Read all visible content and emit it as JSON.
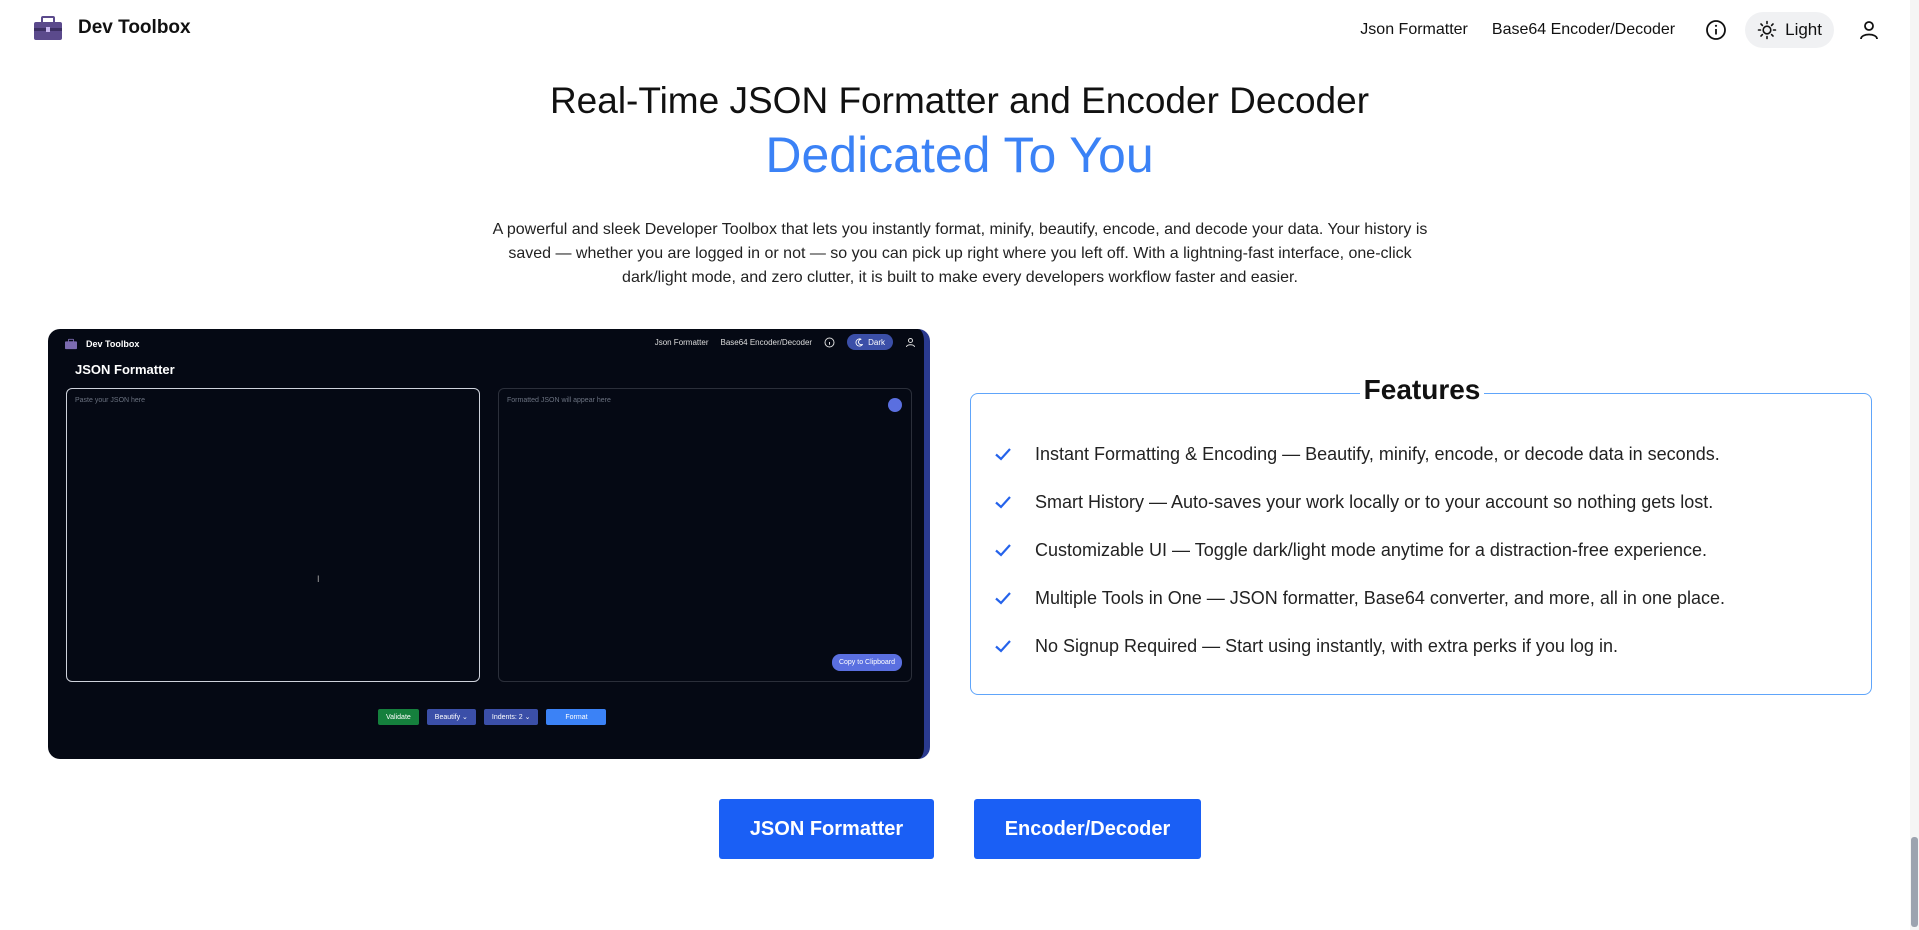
{
  "header": {
    "brand": "Dev Toolbox",
    "nav": {
      "json_link": "Json Formatter",
      "base64_link": "Base64 Encoder/Decoder",
      "theme_label": "Light"
    }
  },
  "hero": {
    "title": "Real-Time JSON Formatter and Encoder Decoder",
    "subtitle": "Dedicated To You",
    "description": "A powerful and sleek Developer Toolbox that lets you instantly format, minify, beautify, encode, and decode your data. Your history is saved — whether you are logged in or not — so you can pick up right where you left off. With a lightning-fast interface, one-click dark/light mode, and zero clutter, it is built to make every developers workflow faster and easier."
  },
  "preview": {
    "brand": "Dev Toolbox",
    "nav_json": "Json Formatter",
    "nav_base64": "Base64 Encoder/Decoder",
    "theme_label": "Dark",
    "title": "JSON Formatter",
    "input_placeholder": "Paste your JSON here",
    "output_placeholder": "Formatted JSON will appear here",
    "copy_label": "Copy to Clipboard",
    "validate_label": "Validate",
    "mode_label": "Beautify",
    "indents_label": "Indents: 2",
    "format_label": "Format"
  },
  "features": {
    "title": "Features",
    "items": [
      "Instant Formatting & Encoding — Beautify, minify, encode, or decode data in seconds.",
      "Smart History — Auto-saves your work locally or to your account so nothing gets lost.",
      "Customizable UI — Toggle dark/light mode anytime for a distraction-free experience.",
      "Multiple Tools in One — JSON formatter, Base64 converter, and more, all in one place.",
      "No Signup Required — Start using instantly, with extra perks if you log in."
    ]
  },
  "cta": {
    "json_label": "JSON Formatter",
    "encoder_label": "Encoder/Decoder"
  },
  "colors": {
    "accent": "#3b82f6",
    "cta": "#1a5ff5",
    "preview_bg": "#050914"
  }
}
